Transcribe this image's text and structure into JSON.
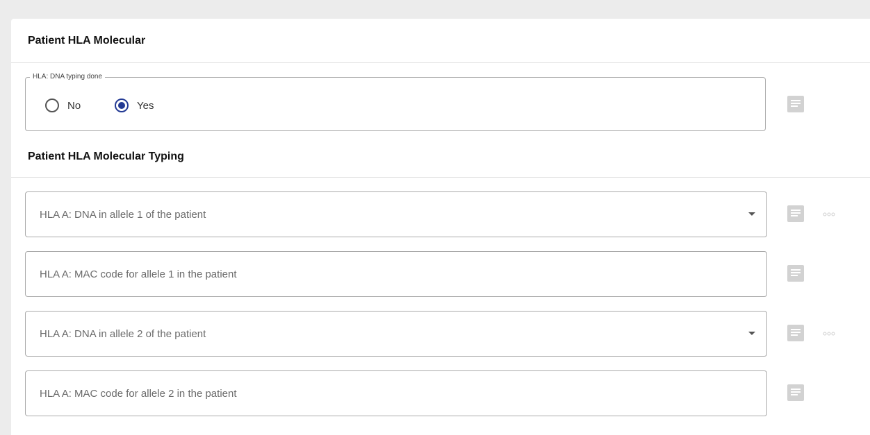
{
  "sections": {
    "molecular": {
      "title": "Patient HLA Molecular"
    },
    "typing": {
      "title": "Patient HLA Molecular Typing"
    }
  },
  "dna_typing": {
    "legend": "HLA: DNA typing done",
    "options": [
      {
        "label": "No",
        "checked": false
      },
      {
        "label": "Yes",
        "checked": true
      }
    ],
    "selected": "Yes"
  },
  "fields": [
    {
      "label": "HLA A: DNA in allele 1 of the patient",
      "type": "dropdown",
      "icons": [
        "comment-icon",
        "more-icon"
      ]
    },
    {
      "label": "HLA A: MAC code for allele 1 in the patient",
      "type": "text",
      "icons": [
        "comment-icon"
      ]
    },
    {
      "label": "HLA A: DNA in allele 2 of the patient",
      "type": "dropdown",
      "icons": [
        "comment-icon",
        "more-icon"
      ]
    },
    {
      "label": "HLA A: MAC code for allele 2 in the patient",
      "type": "text",
      "icons": [
        "comment-icon"
      ]
    }
  ],
  "colors": {
    "accent": "#233a94",
    "icon": "#d2d2d2",
    "border": "#a9a9a9",
    "background": "#ececec"
  }
}
